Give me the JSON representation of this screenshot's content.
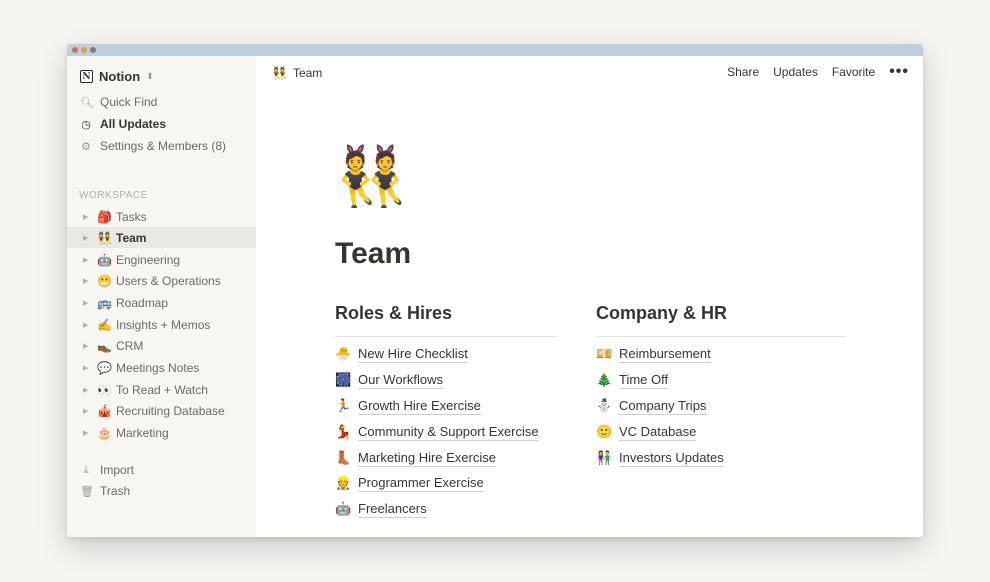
{
  "workspace": {
    "name": "Notion"
  },
  "sidebar": {
    "quick_find": "Quick Find",
    "all_updates": "All Updates",
    "settings": "Settings & Members (8)",
    "section_label": "WORKSPACE",
    "pages": [
      {
        "emoji": "🎒",
        "label": "Tasks"
      },
      {
        "emoji": "👯",
        "label": "Team"
      },
      {
        "emoji": "🤖",
        "label": "Engineering"
      },
      {
        "emoji": "😬",
        "label": "Users & Operations"
      },
      {
        "emoji": "🚌",
        "label": "Roadmap"
      },
      {
        "emoji": "✍️",
        "label": "Insights + Memos"
      },
      {
        "emoji": "👞",
        "label": "CRM"
      },
      {
        "emoji": "💬",
        "label": "Meetings Notes"
      },
      {
        "emoji": "👀",
        "label": "To Read + Watch"
      },
      {
        "emoji": "🎪",
        "label": "Recruiting Database"
      },
      {
        "emoji": "🎂",
        "label": "Marketing"
      }
    ],
    "import": "Import",
    "trash": "Trash"
  },
  "topbar": {
    "breadcrumb_emoji": "👯",
    "breadcrumb_label": "Team",
    "share": "Share",
    "updates": "Updates",
    "favorite": "Favorite",
    "more": "•••"
  },
  "page": {
    "emoji": "👯",
    "title": "Team",
    "columns": [
      {
        "heading": "Roles & Hires",
        "links": [
          {
            "emoji": "🐣",
            "label": "New Hire Checklist"
          },
          {
            "emoji": "🎆",
            "label": "Our Workflows"
          },
          {
            "emoji": "🏃",
            "label": "Growth Hire Exercise"
          },
          {
            "emoji": "💃",
            "label": "Community & Support Exercise"
          },
          {
            "emoji": "👢",
            "label": "Marketing Hire Exercise"
          },
          {
            "emoji": "👷",
            "label": "Programmer Exercise"
          },
          {
            "emoji": "🤖",
            "label": "Freelancers"
          }
        ]
      },
      {
        "heading": "Company & HR",
        "links": [
          {
            "emoji": "💴",
            "label": "Reimbursement"
          },
          {
            "emoji": "🎄",
            "label": "Time Off"
          },
          {
            "emoji": "⛄",
            "label": "Company Trips"
          },
          {
            "emoji": "🙂",
            "label": "VC Database"
          },
          {
            "emoji": "👫",
            "label": "Investors Updates"
          }
        ]
      }
    ]
  }
}
